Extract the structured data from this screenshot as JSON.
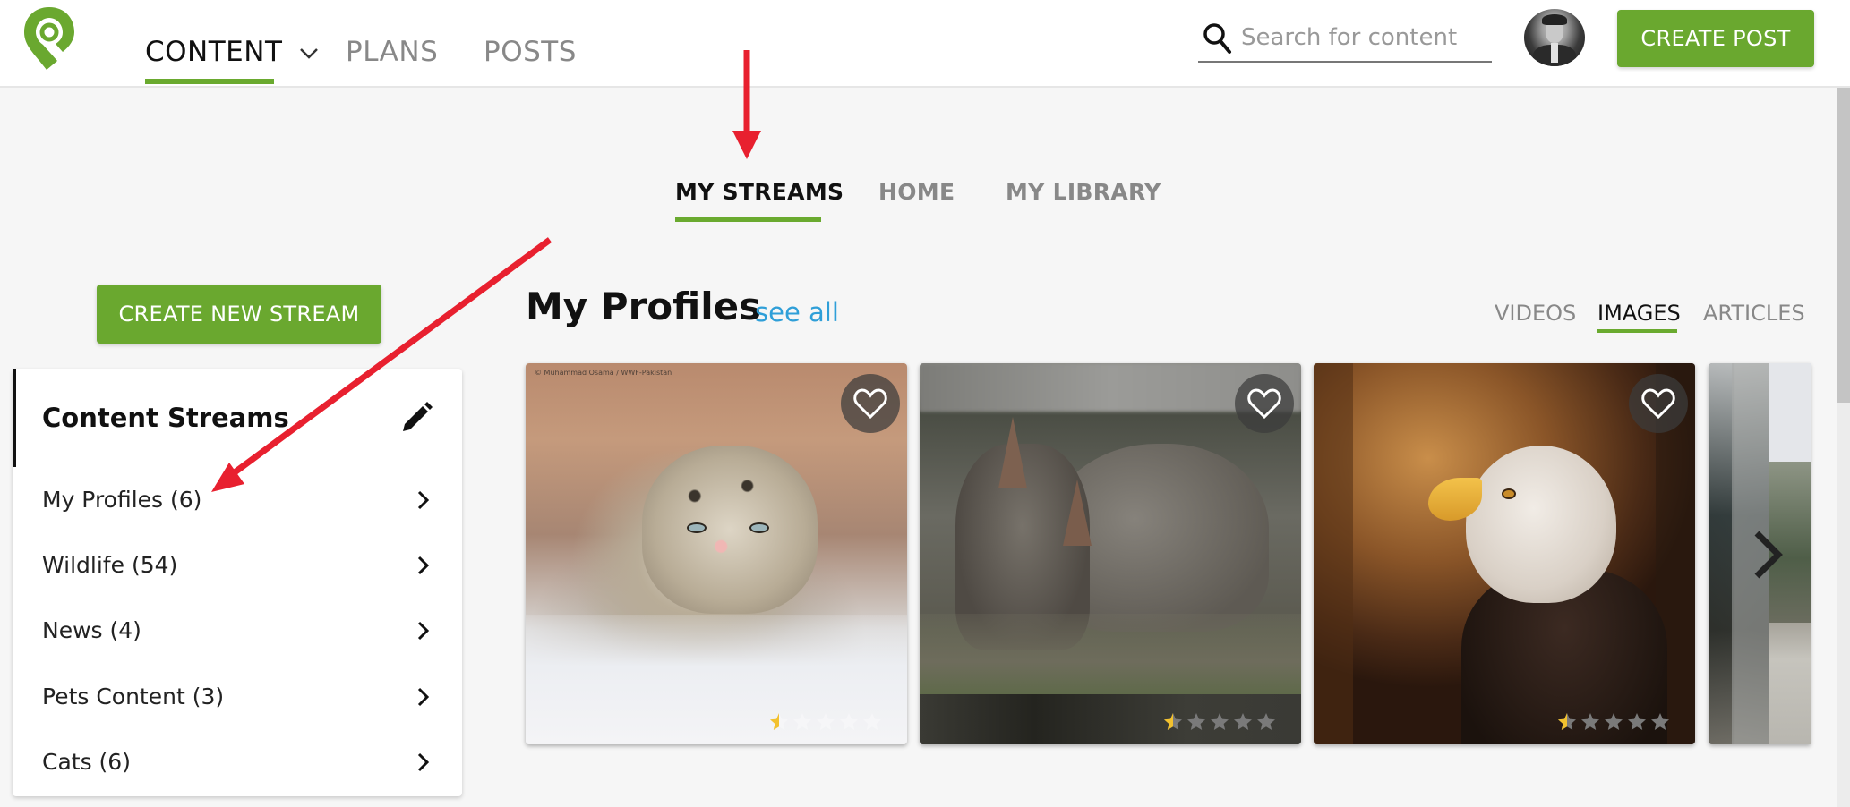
{
  "header": {
    "logo": "periscope-pin-logo",
    "nav": [
      {
        "label": "CONTENT",
        "active": true,
        "has_dropdown": true
      },
      {
        "label": "PLANS",
        "active": false
      },
      {
        "label": "POSTS",
        "active": false
      }
    ],
    "search": {
      "placeholder": "Search for content",
      "value": ""
    },
    "avatar": "user-avatar",
    "create_post_label": "CREATE POST"
  },
  "subtabs": [
    {
      "label": "MY STREAMS",
      "active": true
    },
    {
      "label": "HOME",
      "active": false
    },
    {
      "label": "MY LIBRARY",
      "active": false
    }
  ],
  "sidebar": {
    "create_stream_label": "CREATE NEW STREAM",
    "card_title": "Content Streams",
    "edit_icon": "pencil-icon",
    "items": [
      {
        "label": "My Profiles (6)",
        "name": "My Profiles",
        "count": 6
      },
      {
        "label": "Wildlife (54)",
        "name": "Wildlife",
        "count": 54
      },
      {
        "label": "News (4)",
        "name": "News",
        "count": 4
      },
      {
        "label": "Pets Content (3)",
        "name": "Pets Content",
        "count": 3
      },
      {
        "label": "Cats (6)",
        "name": "Cats",
        "count": 6
      }
    ]
  },
  "main": {
    "section_title": "My Profiles",
    "see_all_label": "see all",
    "type_tabs": [
      {
        "label": "VIDEOS",
        "active": false
      },
      {
        "label": "IMAGES",
        "active": true
      },
      {
        "label": "ARTICLES",
        "active": false
      }
    ],
    "cards": [
      {
        "subject": "snow leopard",
        "credit": "© Muhammad Osama / WWF-Pakistan",
        "rating": 0.5,
        "max_rating": 5,
        "favorited": false
      },
      {
        "subject": "rhinoceros pair",
        "credit": "",
        "rating": 0.5,
        "max_rating": 5,
        "favorited": false
      },
      {
        "subject": "bald eagle",
        "credit": "",
        "rating": 0.5,
        "max_rating": 5,
        "favorited": false
      },
      {
        "subject": "mountain lake",
        "credit": "",
        "partial": true
      }
    ],
    "next_icon": "chevron-right-icon"
  },
  "colors": {
    "brand_green": "#6aa82f",
    "link_blue": "#2f9fd8",
    "annotation_red": "#e8202f",
    "star_gold": "#f2c12e",
    "star_gray": "#7a7a7a"
  },
  "annotations": [
    {
      "type": "arrow",
      "points_to": "MY STREAMS tab"
    },
    {
      "type": "arrow",
      "points_to": "My Profiles (6) stream"
    }
  ]
}
